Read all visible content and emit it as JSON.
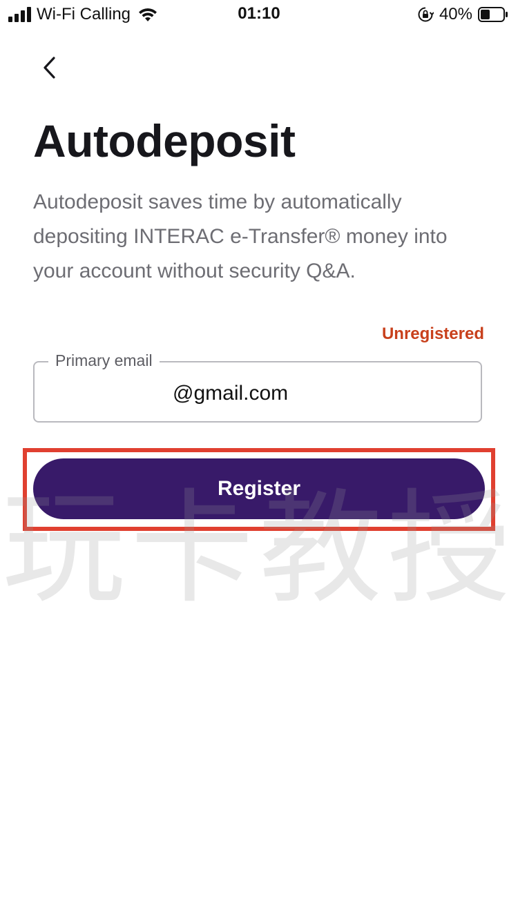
{
  "status_bar": {
    "carrier": "Wi-Fi Calling",
    "time": "01:10",
    "battery": "40%",
    "icons": [
      "signal-bars-icon",
      "wifi-icon",
      "orientation-lock-icon",
      "battery-icon"
    ]
  },
  "nav": {
    "back_icon": "chevron-left-icon"
  },
  "page": {
    "title": "Autodeposit",
    "description": "Autodeposit saves time by automatically depositing INTERAC e-Transfer® money into your account without security Q&A."
  },
  "registration": {
    "status": "Unregistered",
    "status_color": "#c8401c"
  },
  "email_field": {
    "label": "Primary email",
    "value": "@gmail.com"
  },
  "register_button": {
    "label": "Register",
    "color": "#381a69"
  },
  "annotation": {
    "highlight_color": "#e04030"
  },
  "watermark": {
    "text": "玩卡教授"
  }
}
